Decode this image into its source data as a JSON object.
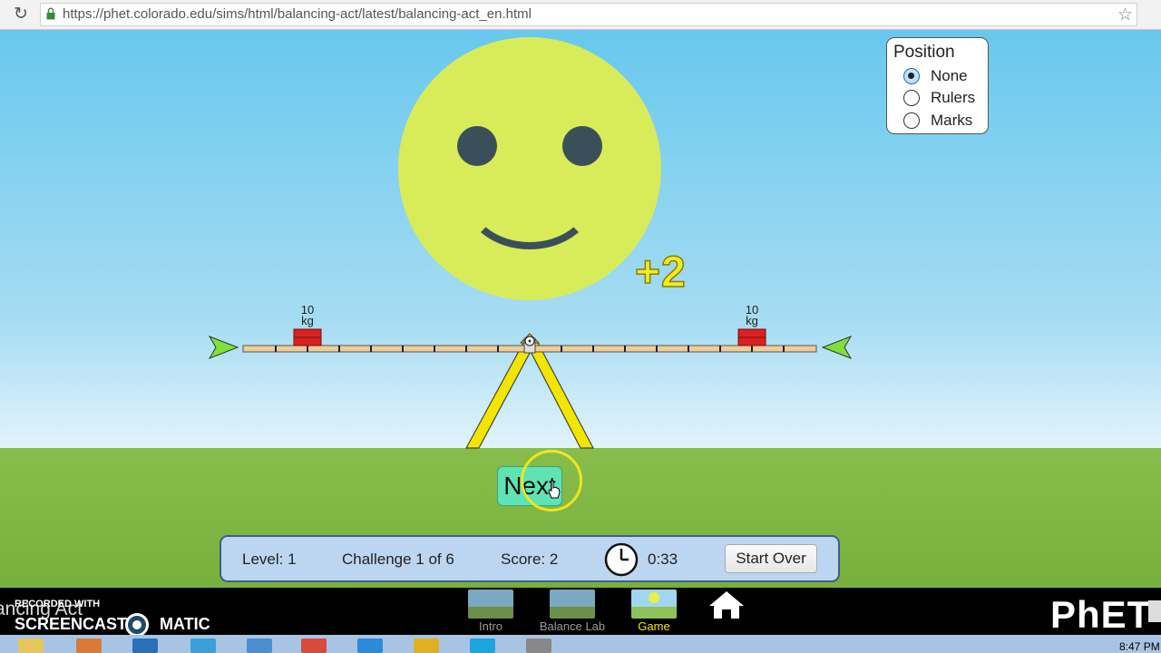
{
  "browser": {
    "url": "https://phet.colorado.edu/sims/html/balancing-act/latest/balancing-act_en.html"
  },
  "feedback": {
    "points": "+2"
  },
  "position_panel": {
    "title": "Position",
    "options": [
      {
        "label": "None",
        "selected": true
      },
      {
        "label": "Rulers",
        "selected": false
      },
      {
        "label": "Marks",
        "selected": false
      }
    ]
  },
  "masses": [
    {
      "value": "10",
      "unit": "kg"
    },
    {
      "value": "10",
      "unit": "kg"
    }
  ],
  "next_button": {
    "label": "Next"
  },
  "status_bar": {
    "level": "Level: 1",
    "challenge": "Challenge 1 of 6",
    "score": "Score: 2",
    "time": "0:33",
    "start_over": "Start Over"
  },
  "navbar": {
    "sim_title_fragment": "ancing Act",
    "screencast": {
      "recorded_with": "RECORDED WITH",
      "brand_left": "SCREENCAST",
      "brand_right": "MATIC"
    },
    "tabs": [
      {
        "label": "Intro"
      },
      {
        "label": "Balance Lab"
      },
      {
        "label": "Game"
      }
    ],
    "logo": "PhET"
  },
  "taskbar": {
    "time": "8:47 PM"
  },
  "colors": {
    "smiley": "#d8ec5a",
    "plank": "#f0cc96",
    "mass": "#d92121",
    "support": "#f2e600",
    "next_button": "#5fe3b4",
    "active_tab": "#f2e600"
  }
}
